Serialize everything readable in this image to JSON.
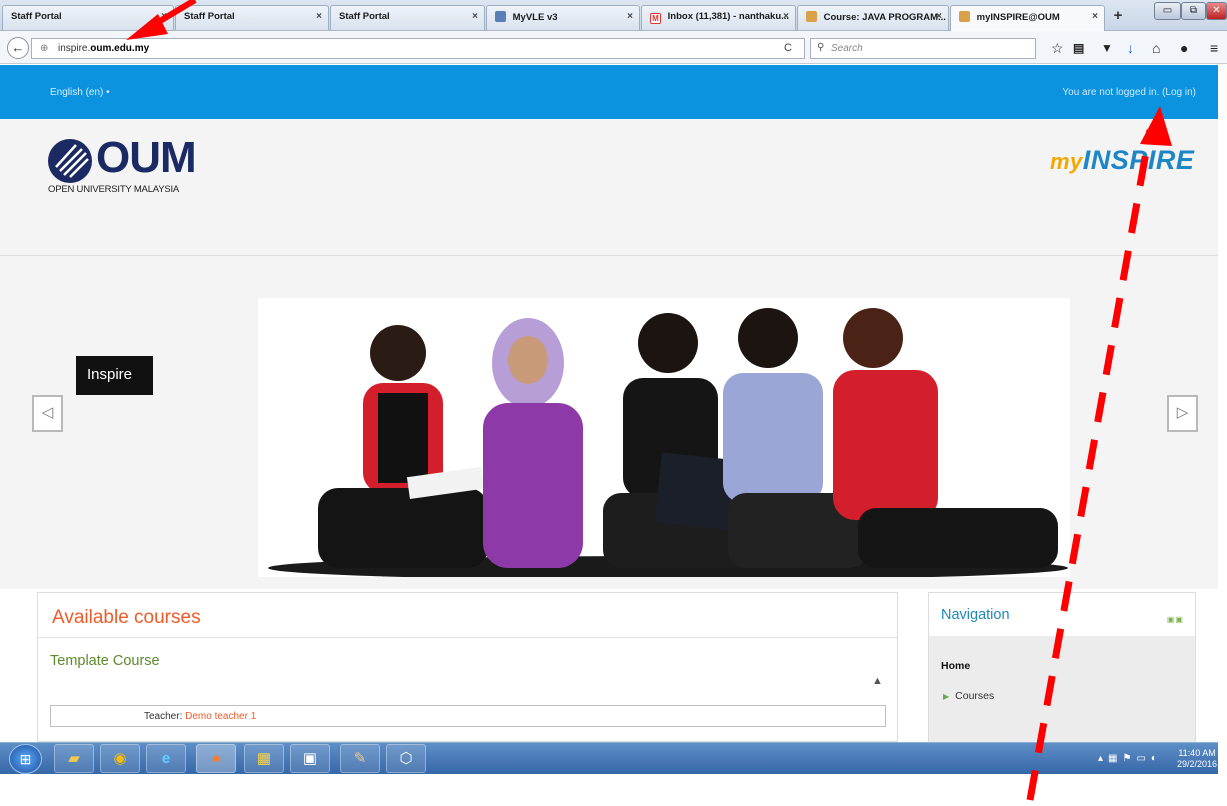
{
  "browser": {
    "tabs": [
      {
        "title": "Staff Portal",
        "close": "×"
      },
      {
        "title": "Staff Portal",
        "close": "×"
      },
      {
        "title": "Staff Portal",
        "close": "×"
      },
      {
        "title": "MyVLE v3",
        "close": "×"
      },
      {
        "title": "Inbox (11,381) - nanthaku...",
        "close": "×"
      },
      {
        "title": "Course: JAVA PROGRAM...",
        "close": "×"
      },
      {
        "title": "myINSPIRE@OUM",
        "close": "×"
      }
    ],
    "new_tab": "+",
    "url_prefix": "inspire.",
    "url_domain": "oum.edu.my",
    "search_placeholder": "Search",
    "toolbar_icons": [
      "star-icon",
      "clipboard-icon",
      "pocket-icon",
      "download-icon",
      "home-icon",
      "chat-icon",
      "menu-icon"
    ]
  },
  "site": {
    "language": "English (en) •",
    "login_text": "You are not logged in. (Log in)",
    "logo_word": "OUM",
    "logo_subtitle": "OPEN UNIVERSITY MALAYSIA",
    "brand_my": "my",
    "brand_inspire": "INSPIRE"
  },
  "slider": {
    "caption": "Inspire",
    "prev": "◁",
    "next": "▷"
  },
  "courses": {
    "heading": "Available courses",
    "items": [
      {
        "name": "Template Course",
        "teacher_label": "Teacher: ",
        "teacher_name": "Demo teacher 1"
      }
    ]
  },
  "navigation": {
    "title": "Navigation",
    "home": "Home",
    "courses": "Courses"
  },
  "taskbar": {
    "time": "11:40 AM",
    "date": "29/2/2016"
  },
  "colors": {
    "topbar": "#0b93e0",
    "accent_orange": "#ef5a29",
    "course_green": "#5b8a2a",
    "annotation_red": "#ff0000"
  }
}
